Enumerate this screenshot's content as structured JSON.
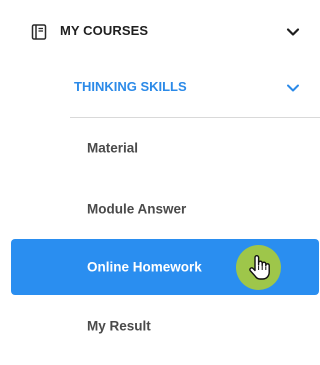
{
  "menu": {
    "section": {
      "label": "MY COURSES",
      "icon": "book-icon",
      "chevron": "chevron-down-icon"
    },
    "course": {
      "label": "THINKING SKILLS",
      "chevron": "chevron-down-icon",
      "color": "#2b8ae8"
    },
    "items": [
      {
        "label": "Material"
      },
      {
        "label": "Module Answer"
      },
      {
        "label": "Online Homework",
        "active": true
      },
      {
        "label": "My Result"
      }
    ],
    "active_color": "#2a8ef0",
    "cursor": {
      "icon": "hand-pointer-icon",
      "halo_color": "#9ec64a"
    }
  }
}
